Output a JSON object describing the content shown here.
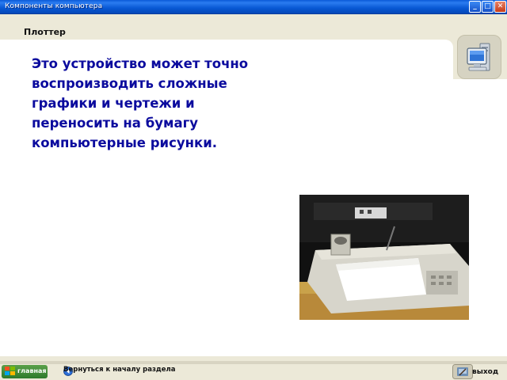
{
  "window": {
    "title": "Компоненты компьютера",
    "controls": {
      "minimize": "_",
      "maximize": "□",
      "close": "✕"
    }
  },
  "page": {
    "heading": "Плоттер",
    "body_text": "Это устройство может точно воспроизводить сложные графики и чертежи и переносить на бумагу компьютерные рисунки."
  },
  "icons": {
    "computer": "computer-icon",
    "home": "windows-logo-icon",
    "back": "back-arrow-icon",
    "exit": "exit-icon"
  },
  "footer": {
    "home_label": "главная",
    "back_label": "Вернуться к началу раздела",
    "exit_label": "выход"
  },
  "colors": {
    "title_bar": "#0a5ad8",
    "body_text": "#0b0b9e",
    "background": "#ece9d8",
    "sheet": "#ffffff"
  }
}
